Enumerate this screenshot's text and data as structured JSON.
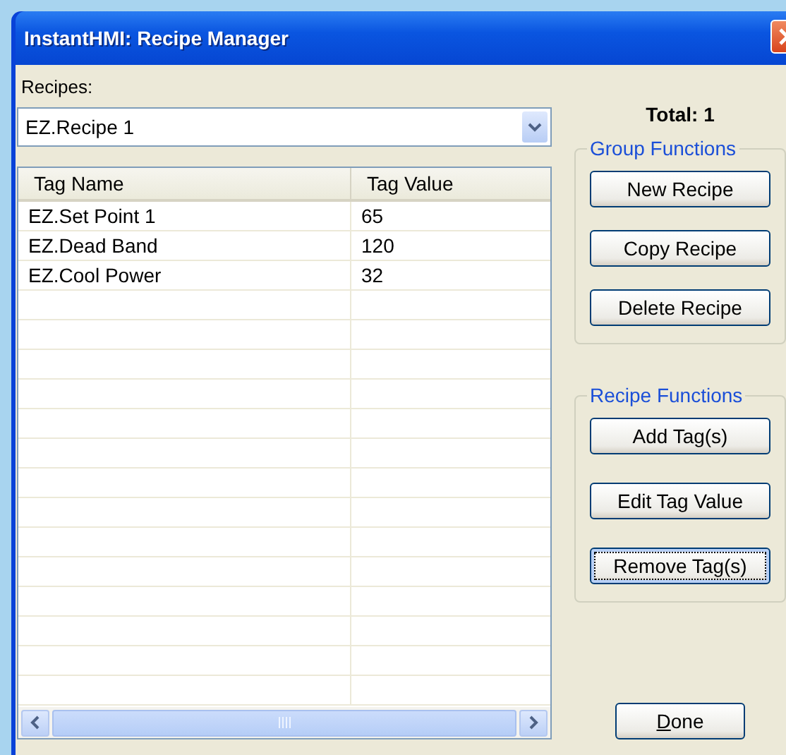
{
  "window": {
    "title": "InstantHMI: Recipe Manager"
  },
  "recipes": {
    "label": "Recipes:",
    "value": "EZ.Recipe 1"
  },
  "total": "Total: 1",
  "table": {
    "columns": [
      "Tag Name",
      "Tag Value"
    ],
    "rows": [
      {
        "name": "EZ.Set Point 1",
        "value": "65"
      },
      {
        "name": "EZ.Dead Band",
        "value": "120"
      },
      {
        "name": "EZ.Cool Power",
        "value": "32"
      }
    ]
  },
  "groups": [
    {
      "title": "Group Functions",
      "buttons": [
        {
          "label": "New Recipe",
          "focused": false
        },
        {
          "label": "Copy Recipe",
          "focused": false
        },
        {
          "label": "Delete Recipe",
          "focused": false
        }
      ]
    },
    {
      "title": "Recipe Functions",
      "buttons": [
        {
          "label": "Add Tag(s)",
          "focused": false
        },
        {
          "label": "Edit Tag Value",
          "focused": false
        },
        {
          "label": "Remove Tag(s)",
          "focused": true
        }
      ]
    }
  ],
  "done_button": {
    "label": "Done"
  }
}
